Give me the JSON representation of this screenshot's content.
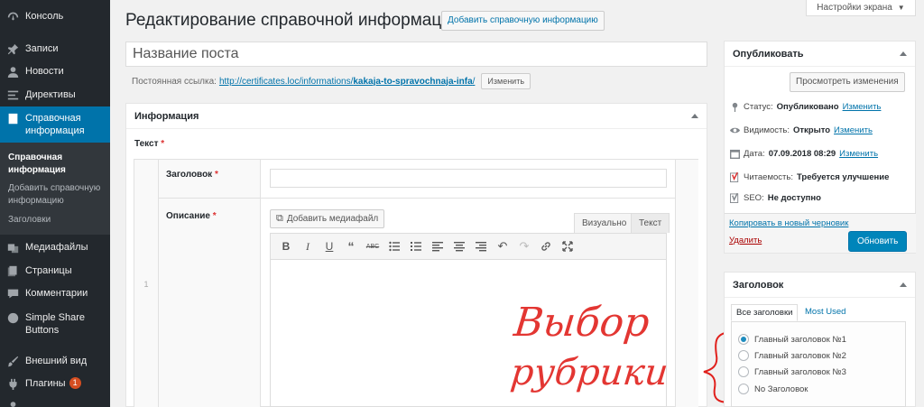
{
  "sidebar": {
    "items": [
      {
        "label": "Консоль",
        "icon": "dashboard-icon"
      },
      {
        "label": "Записи",
        "icon": "pin-icon"
      },
      {
        "label": "Новости",
        "icon": "user-icon"
      },
      {
        "label": "Директивы",
        "icon": "list-icon"
      },
      {
        "label": "Справочная информация",
        "icon": "document-icon"
      },
      {
        "label": "Медиафайлы",
        "icon": "media-icon"
      },
      {
        "label": "Страницы",
        "icon": "pages-icon"
      },
      {
        "label": "Комментарии",
        "icon": "comment-icon"
      },
      {
        "label": "Simple Share Buttons",
        "icon": "share-icon"
      },
      {
        "label": "Внешний вид",
        "icon": "brush-icon"
      },
      {
        "label": "Плагины",
        "icon": "plugin-icon",
        "badge": "1"
      }
    ],
    "submenu": [
      {
        "label": "Справочная информация"
      },
      {
        "label": "Добавить справочную информацию"
      },
      {
        "label": "Заголовки"
      }
    ]
  },
  "top": {
    "screen_options": "Настройки экрана",
    "page_title": "Редактирование справочной информации",
    "add_new": "Добавить справочную информацию"
  },
  "post": {
    "title_placeholder": "Название поста",
    "permalink_label": "Постоянная ссылка:",
    "permalink_base": "http://certificates.loc/informations/",
    "permalink_slug": "kakaja-to-spravochnaja-infa",
    "permalink_tail": "/",
    "edit_label": "Изменить"
  },
  "info_box": {
    "title": "Информация",
    "text_label": "Текст",
    "row_index": "1",
    "heading_label": "Заголовок",
    "description_label": "Описание",
    "add_media": "Добавить медиафайл",
    "tab_visual": "Визуально",
    "tab_text": "Текст"
  },
  "publish": {
    "title": "Опубликовать",
    "preview": "Просмотреть изменения",
    "status_label": "Статус:",
    "status_value": "Опубликовано",
    "visibility_label": "Видимость:",
    "visibility_value": "Открыто",
    "date_label": "Дата:",
    "date_value": "07.09.2018 08:29",
    "edit": "Изменить",
    "readability_label": "Читаемость:",
    "readability_value": "Требуется улучшение",
    "seo_label": "SEO:",
    "seo_value": "Не доступно",
    "copy_draft": "Копировать в новый черновик",
    "delete": "Удалить",
    "update": "Обновить"
  },
  "heading_box": {
    "title": "Заголовок",
    "tab_all": "Все заголовки",
    "tab_used": "Most Used",
    "options": [
      {
        "label": "Главный заголовок №1",
        "checked": true
      },
      {
        "label": "Главный заголовок №2",
        "checked": false
      },
      {
        "label": "Главный заголовок №3",
        "checked": false
      },
      {
        "label": "No Заголовок",
        "checked": false
      }
    ]
  },
  "annotation": {
    "line1": "Выбор",
    "line2": "рубрики",
    "color": "#e0201c"
  }
}
